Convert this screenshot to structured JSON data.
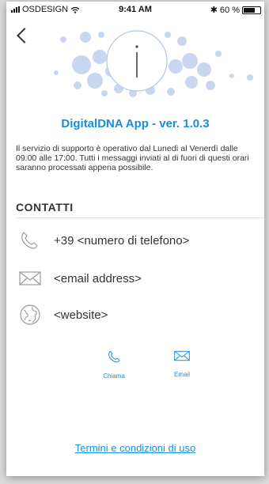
{
  "status_bar": {
    "carrier": "OSDESIGN",
    "time": "9:41 AM",
    "battery": "60 %"
  },
  "header": {
    "back_icon": "chevron-left-icon",
    "hero_icon": "info-icon"
  },
  "app_title": "DigitalDNA App - ver. 1.0.3",
  "support_text": "Il servizio di supporto è operativo dal Lunedì al Venerdì dalle 09:00 alle 17:00. Tutti i messaggi inviati al di fuori di questi orari saranno processati appena possibile.",
  "contacts": {
    "heading": "CONTATTI",
    "phone": "+39 <numero di telefono>",
    "email": "<email address>",
    "website": "<website>"
  },
  "actions": {
    "call_label": "Chiama",
    "email_label": "Email"
  },
  "footer": {
    "terms_link": "Termini e condizioni di uso"
  },
  "colors": {
    "accent": "#1a8fd6",
    "dots": "#c5d3ec",
    "text": "#333333"
  }
}
